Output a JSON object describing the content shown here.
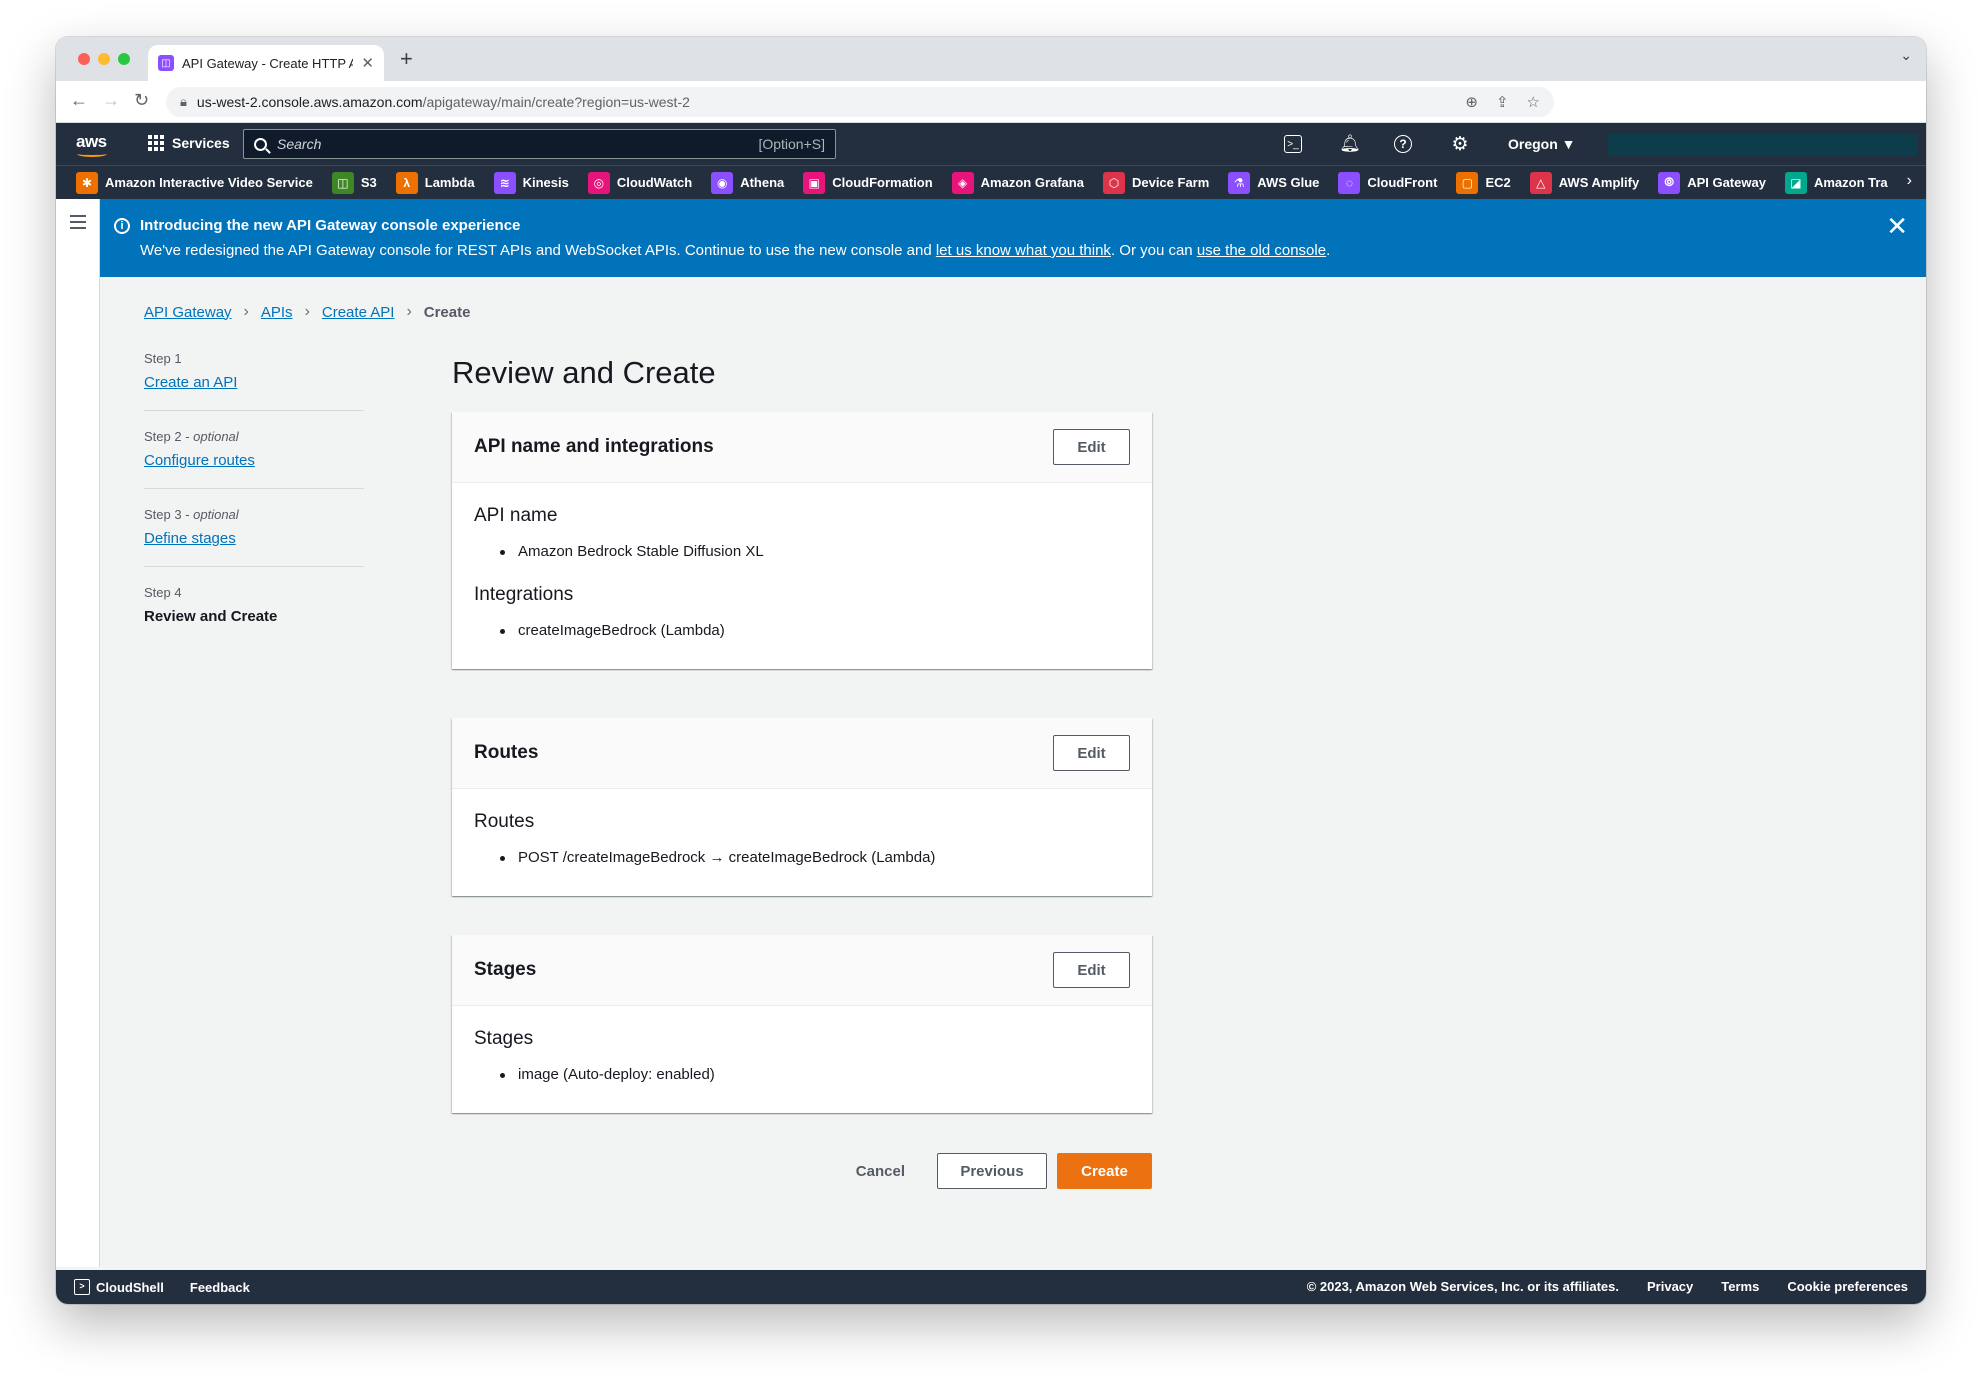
{
  "browser": {
    "tab_title": "API Gateway - Create HTTP A",
    "url_host": "us-west-2.console.aws.amazon.com",
    "url_path": "/apigateway/main/create?region=us-west-2"
  },
  "awsnav": {
    "logo": "aws",
    "services_label": "Services",
    "search_placeholder": "Search",
    "search_shortcut": "[Option+S]",
    "region": "Oregon ▼"
  },
  "favorites": [
    {
      "label": "Amazon Interactive Video Service",
      "color": "#ed7100",
      "icon": "ivs-icon"
    },
    {
      "label": "S3",
      "color": "#3f8624",
      "icon": "s3-icon"
    },
    {
      "label": "Lambda",
      "color": "#ed7100",
      "icon": "lambda-icon"
    },
    {
      "label": "Kinesis",
      "color": "#8c4fff",
      "icon": "kinesis-icon"
    },
    {
      "label": "CloudWatch",
      "color": "#e7157b",
      "icon": "cloudwatch-icon"
    },
    {
      "label": "Athena",
      "color": "#8c4fff",
      "icon": "athena-icon"
    },
    {
      "label": "CloudFormation",
      "color": "#e7157b",
      "icon": "cloudformation-icon"
    },
    {
      "label": "Amazon Grafana",
      "color": "#e7157b",
      "icon": "grafana-icon"
    },
    {
      "label": "Device Farm",
      "color": "#dd344c",
      "icon": "devicefarm-icon"
    },
    {
      "label": "AWS Glue",
      "color": "#8c4fff",
      "icon": "glue-icon"
    },
    {
      "label": "CloudFront",
      "color": "#8c4fff",
      "icon": "cloudfront-icon"
    },
    {
      "label": "EC2",
      "color": "#ed7100",
      "icon": "ec2-icon"
    },
    {
      "label": "AWS Amplify",
      "color": "#dd344c",
      "icon": "amplify-icon"
    },
    {
      "label": "API Gateway",
      "color": "#8c4fff",
      "icon": "apigateway-icon"
    },
    {
      "label": "Amazon Tra",
      "color": "#01a88d",
      "icon": "transcribe-icon"
    }
  ],
  "flash": {
    "title": "Introducing the new API Gateway console experience",
    "body_start": "We've redesigned the API Gateway console for REST APIs and WebSocket APIs. Continue to use the new console and ",
    "link1": "let us know what you think",
    "body_mid": ". Or you can ",
    "link2": "use the old console",
    "body_end": "."
  },
  "breadcrumb": {
    "items": [
      "API Gateway",
      "APIs",
      "Create API"
    ],
    "current": "Create"
  },
  "wizard": {
    "steps": [
      {
        "num": "Step 1",
        "optional": "",
        "label": "Create an API"
      },
      {
        "num": "Step 2 - ",
        "optional": "optional",
        "label": "Configure routes"
      },
      {
        "num": "Step 3 - ",
        "optional": "optional",
        "label": "Define stages"
      },
      {
        "num": "Step 4",
        "optional": "",
        "label": "Review and Create"
      }
    ]
  },
  "page_title": "Review and Create",
  "cards": {
    "api": {
      "title": "API name and integrations",
      "edit": "Edit",
      "name_label": "API name",
      "name_value": "Amazon Bedrock Stable Diffusion XL",
      "integrations_label": "Integrations",
      "integrations_value": "createImageBedrock (Lambda)"
    },
    "routes": {
      "title": "Routes",
      "edit": "Edit",
      "label": "Routes",
      "value": "POST /createImageBedrock → createImageBedrock (Lambda)"
    },
    "stages": {
      "title": "Stages",
      "edit": "Edit",
      "label": "Stages",
      "value": "image (Auto-deploy: enabled)"
    }
  },
  "actions": {
    "cancel": "Cancel",
    "previous": "Previous",
    "create": "Create"
  },
  "footer": {
    "cloudshell": "CloudShell",
    "feedback": "Feedback",
    "copyright": "© 2023, Amazon Web Services, Inc. or its affiliates.",
    "privacy": "Privacy",
    "terms": "Terms",
    "cookies": "Cookie preferences"
  }
}
